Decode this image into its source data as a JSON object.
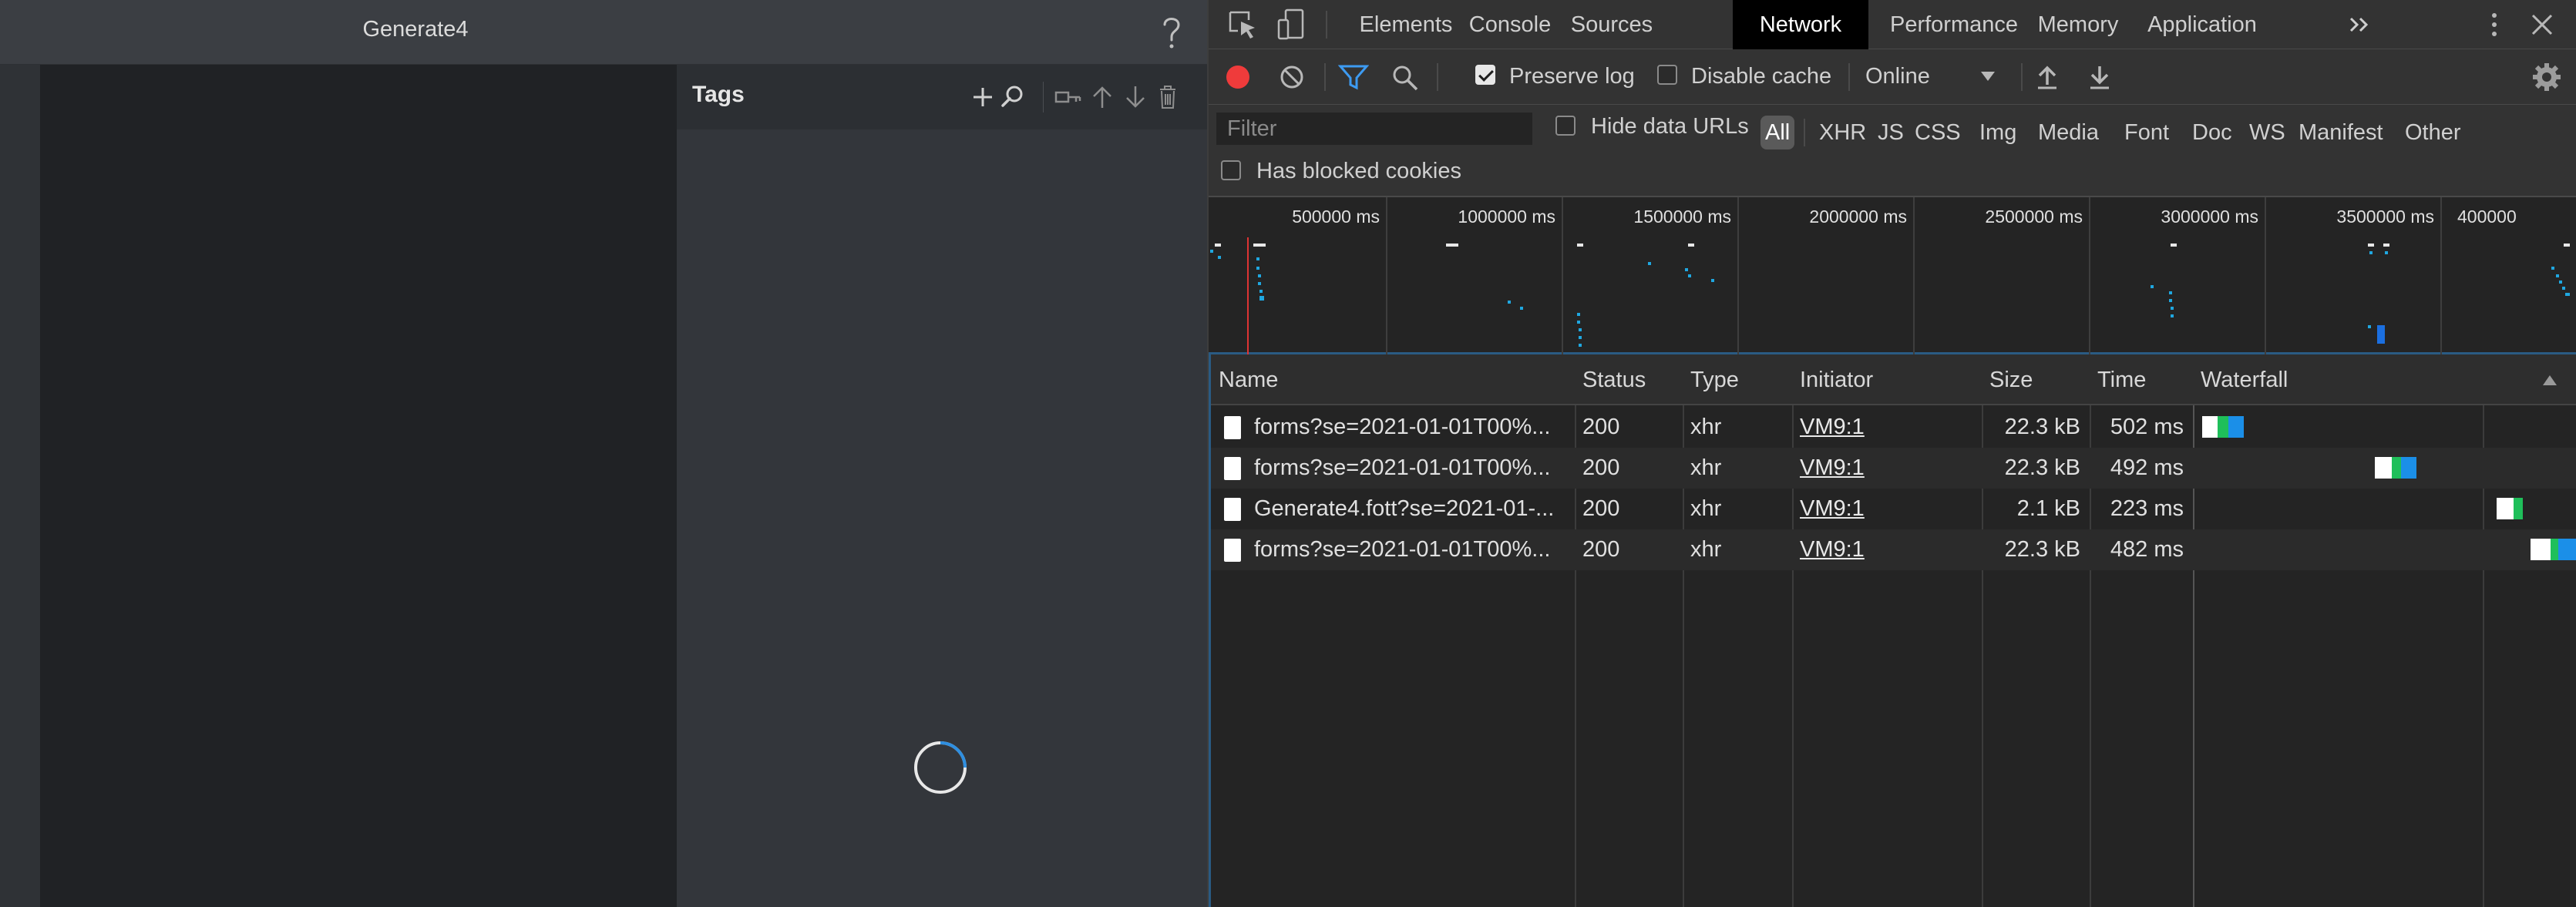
{
  "app": {
    "title": "Generate4",
    "tags_panel": {
      "title": "Tags"
    }
  },
  "devtools": {
    "tabs": [
      "Elements",
      "Console",
      "Sources",
      "Network",
      "Performance",
      "Memory",
      "Application"
    ],
    "active_tab": "Network",
    "toolbar": {
      "preserve_log_label": "Preserve log",
      "preserve_log_checked": true,
      "disable_cache_label": "Disable cache",
      "disable_cache_checked": false,
      "throttling_value": "Online"
    },
    "filter": {
      "placeholder": "Filter",
      "hide_data_urls_label": "Hide data URLs",
      "type_filters": [
        "All",
        "XHR",
        "JS",
        "CSS",
        "Img",
        "Media",
        "Font",
        "Doc",
        "WS",
        "Manifest",
        "Other"
      ],
      "active_type": "All",
      "blocked_cookies_label": "Has blocked cookies"
    },
    "overview": {
      "tick_labels": [
        "500000 ms",
        "1000000 ms",
        "1500000 ms",
        "2000000 ms",
        "2500000 ms",
        "3000000 ms",
        "3500000 ms",
        "400000"
      ]
    },
    "table": {
      "headers": [
        "Name",
        "Status",
        "Type",
        "Initiator",
        "Size",
        "Time",
        "Waterfall"
      ],
      "rows": [
        {
          "name": "forms?se=2021-01-01T00%...",
          "status": "200",
          "type": "xhr",
          "initiator": "VM9:1",
          "size": "22.3 kB",
          "time": "502 ms"
        },
        {
          "name": "forms?se=2021-01-01T00%...",
          "status": "200",
          "type": "xhr",
          "initiator": "VM9:1",
          "size": "22.3 kB",
          "time": "492 ms"
        },
        {
          "name": "Generate4.fott?se=2021-01-...",
          "status": "200",
          "type": "xhr",
          "initiator": "VM9:1",
          "size": "2.1 kB",
          "time": "223 ms"
        },
        {
          "name": "forms?se=2021-01-01T00%...",
          "status": "200",
          "type": "xhr",
          "initiator": "VM9:1",
          "size": "22.3 kB",
          "time": "482 ms"
        }
      ]
    },
    "colors": {
      "record": "#ef3b3b",
      "filter_active": "#3d9bf2",
      "waterfall_waiting": "#1fbf5a",
      "waterfall_download": "#1b8fe8"
    }
  }
}
